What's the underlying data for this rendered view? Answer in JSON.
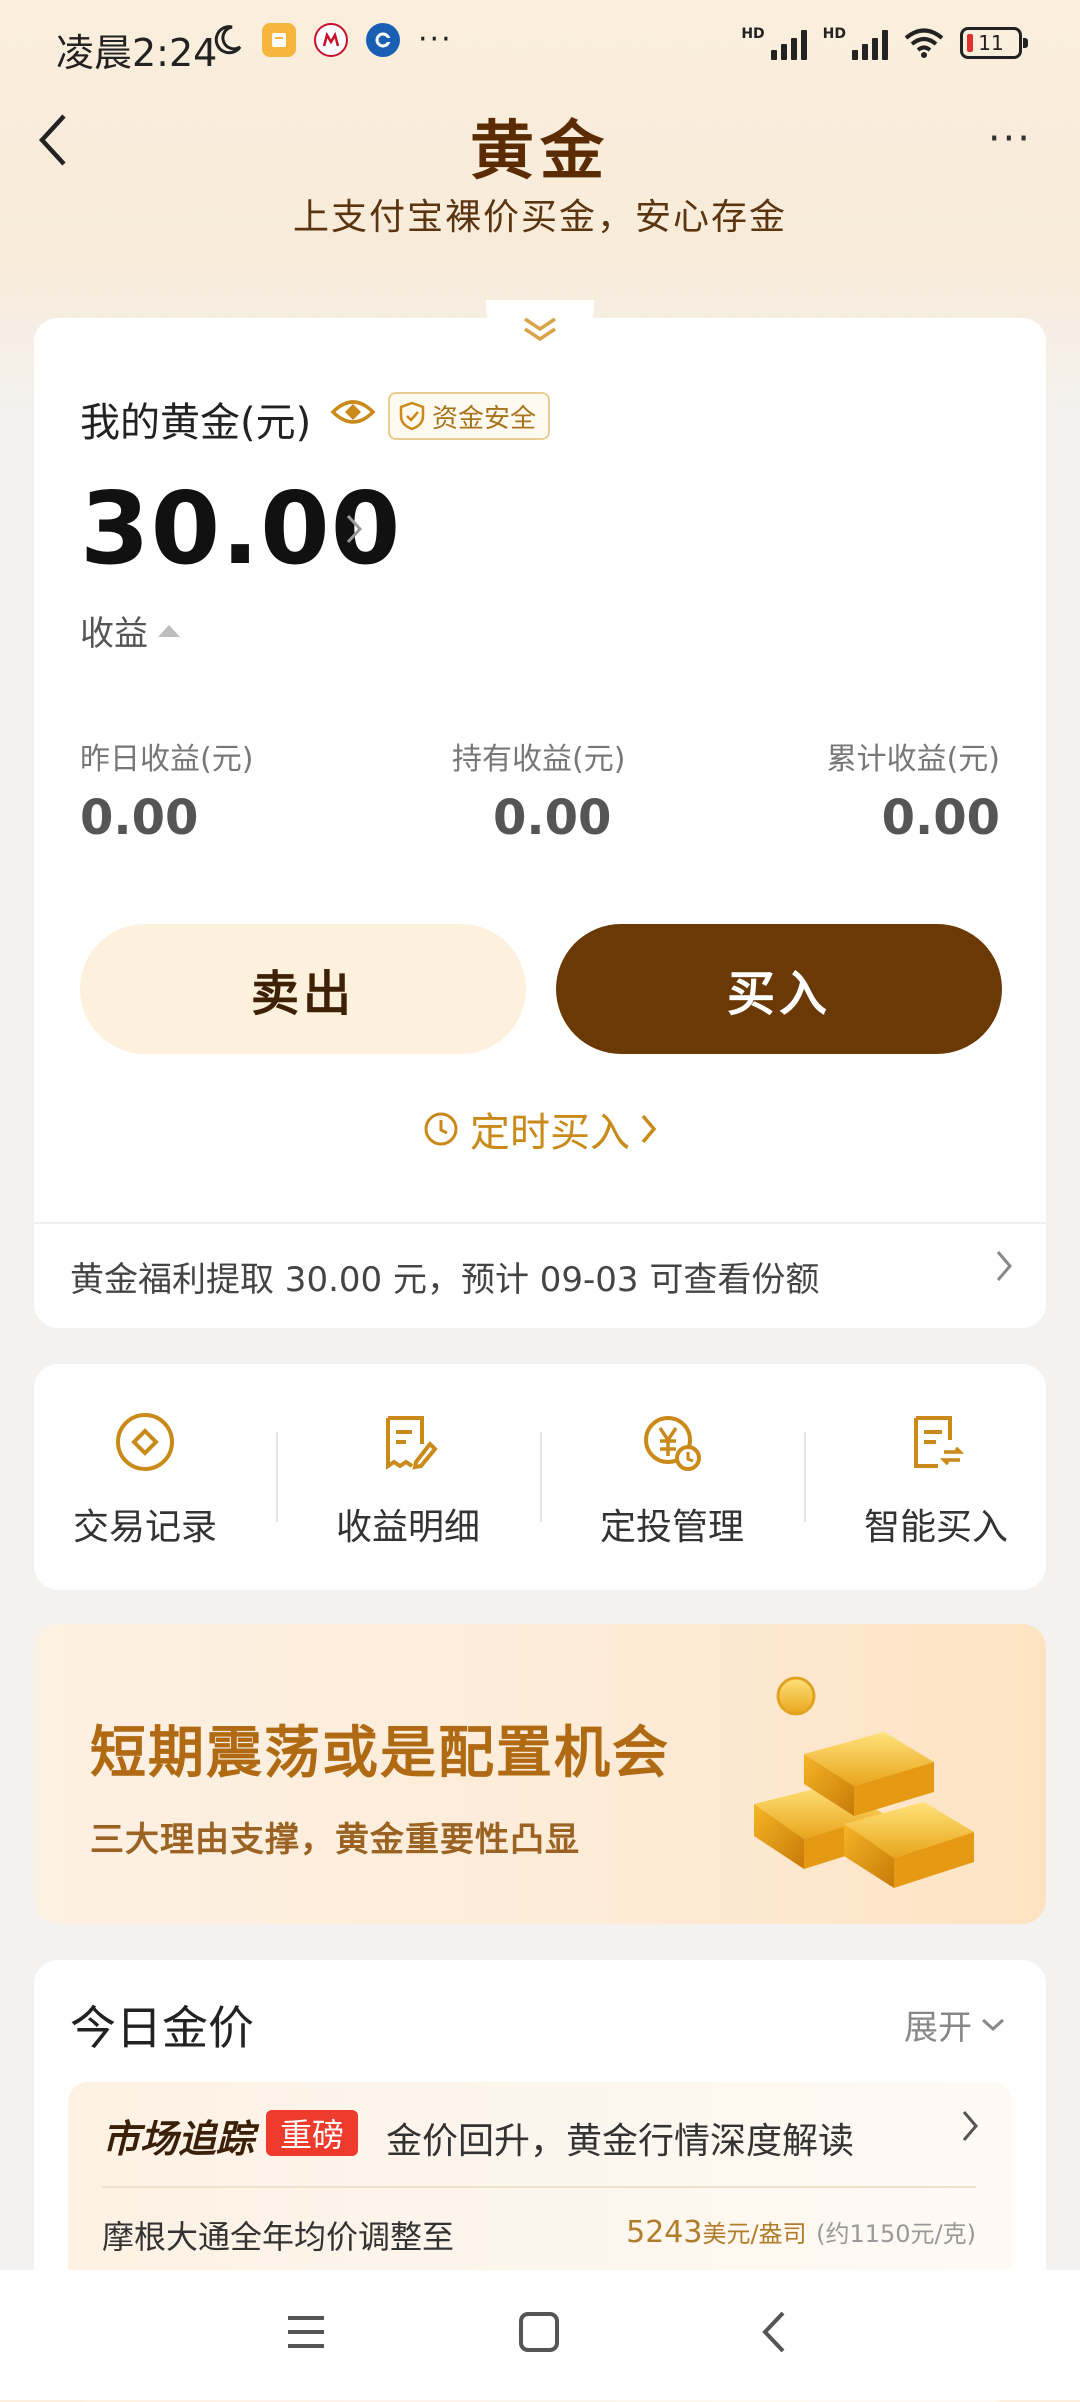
{
  "status_bar": {
    "time": "凌晨2:24",
    "battery": "11",
    "signal1": "HD",
    "signal2": "HD"
  },
  "header": {
    "title": "黄金",
    "subtitle": "上支付宝裸价买金，安心存金"
  },
  "holdings": {
    "label": "我的黄金(元)",
    "safe_badge": "资金安全",
    "balance": "30.00",
    "profit_toggle": "收益",
    "stats": [
      {
        "label": "昨日收益(元)",
        "value": "0.00"
      },
      {
        "label": "持有收益(元)",
        "value": "0.00"
      },
      {
        "label": "累计收益(元)",
        "value": "0.00"
      }
    ],
    "sell_label": "卖出",
    "buy_label": "买入",
    "timed_buy_label": "定时买入",
    "benefit_text": "黄金福利提取 30.00 元，预计 09-03 可查看份额"
  },
  "quick_actions": [
    {
      "label": "交易记录",
      "icon": "transaction-record-icon"
    },
    {
      "label": "收益明细",
      "icon": "earnings-detail-icon"
    },
    {
      "label": "定投管理",
      "icon": "auto-invest-icon"
    },
    {
      "label": "智能买入",
      "icon": "smart-buy-icon"
    }
  ],
  "banner": {
    "title": "短期震荡或是配置机会",
    "subtitle": "三大理由支撑，黄金重要性凸显"
  },
  "today_price": {
    "title": "今日金价",
    "expand_label": "展开",
    "tracker_label": "市场追踪",
    "hot_badge": "重磅",
    "headline": "金价回升，黄金行情深度解读",
    "news_item": "摩根大通全年均价调整至",
    "price_value": "5243",
    "price_unit": "美元/盎司",
    "price_approx": "(约1150元/克)"
  },
  "colors": {
    "brand_brown": "#6b3905",
    "gold_accent": "#c98a1a",
    "hot_red": "#ee3b2c"
  }
}
